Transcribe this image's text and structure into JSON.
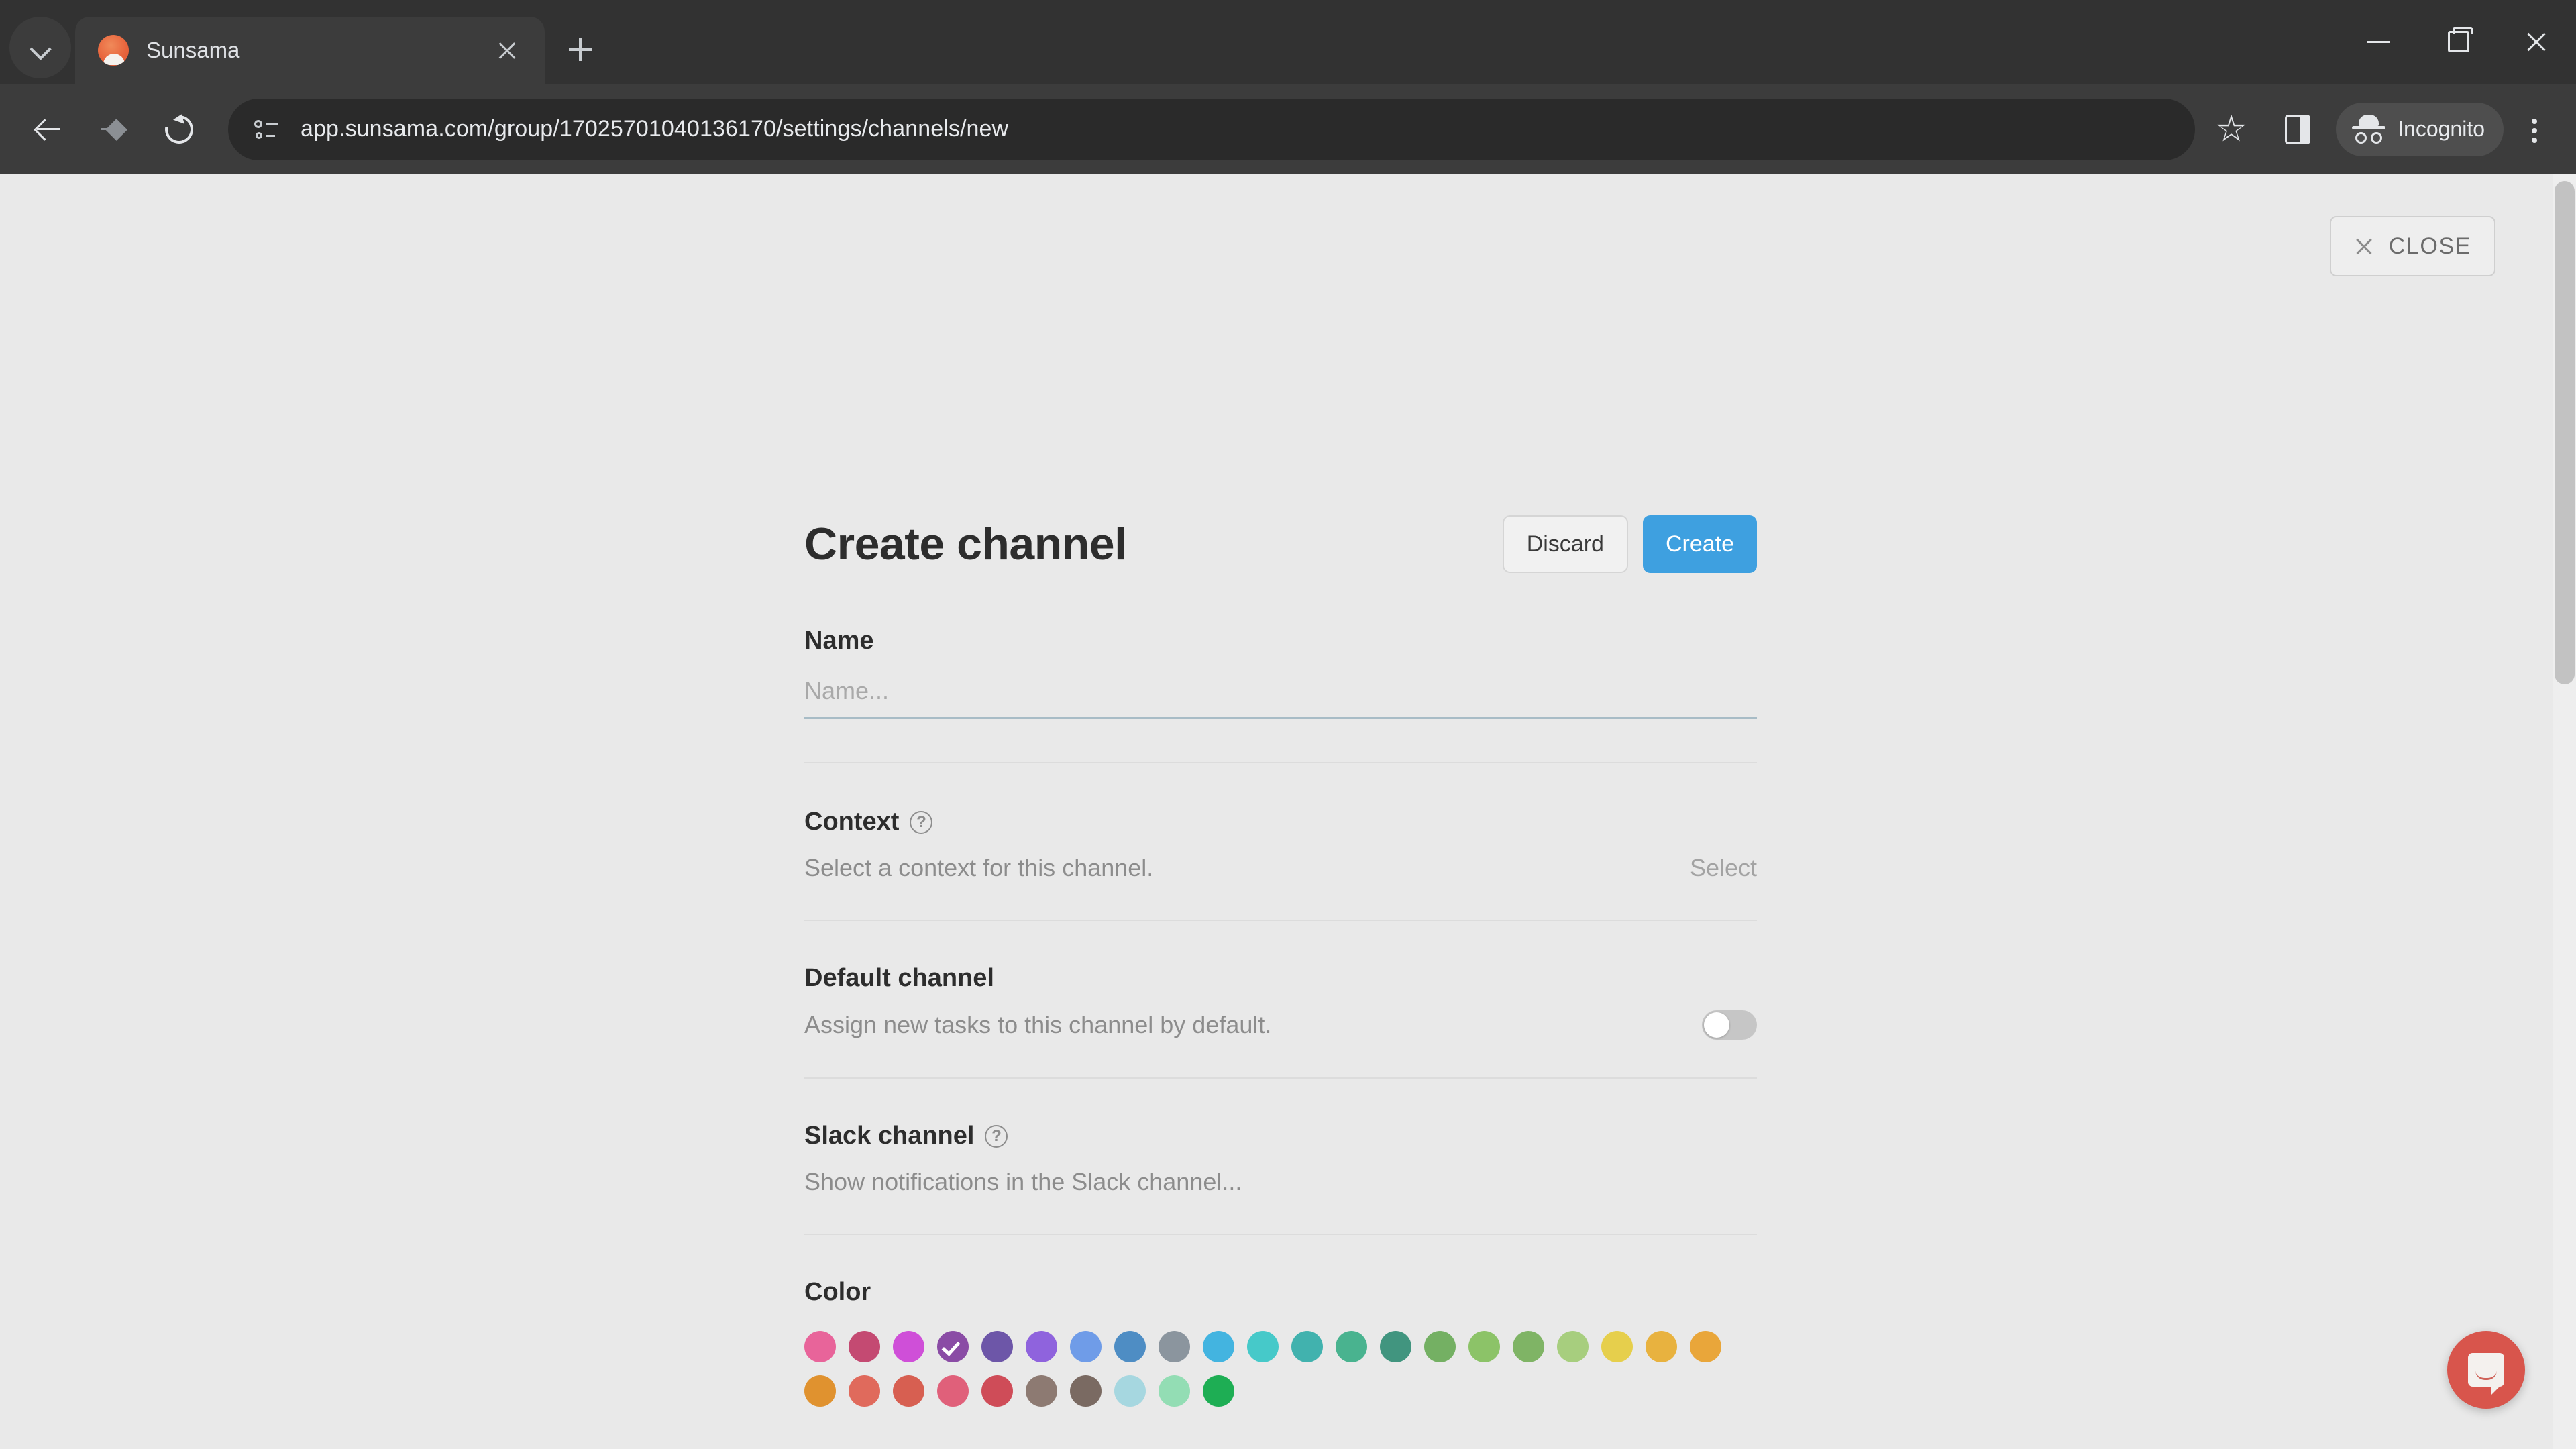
{
  "browser": {
    "tab": {
      "title": "Sunsama",
      "favicon": "sunsama-favicon"
    },
    "url": "app.sunsama.com/group/17025701040136170/settings/channels/new",
    "profile_label": "Incognito",
    "icons": {
      "tab_search": "chevron-down-icon",
      "new_tab": "plus-icon",
      "tab_close": "close-icon",
      "back": "back-arrow-icon",
      "forward": "forward-arrow-icon",
      "reload": "reload-icon",
      "site_info": "site-settings-icon",
      "bookmark": "star-icon",
      "side_panel": "side-panel-icon",
      "incognito": "incognito-spy-icon",
      "menu": "kebab-menu-icon",
      "window_minimize": "minimize-icon",
      "window_maximize": "maximize-icon",
      "window_close": "window-close-icon"
    }
  },
  "page": {
    "close_button": {
      "label": "CLOSE",
      "icon": "close-icon"
    },
    "title": "Create channel",
    "actions": {
      "discard": "Discard",
      "create": "Create"
    },
    "sections": {
      "name": {
        "label": "Name",
        "placeholder": "Name...",
        "value": ""
      },
      "context": {
        "label": "Context",
        "help_icon": "help-circle-icon",
        "description": "Select a context for this channel.",
        "action": "Select"
      },
      "default_channel": {
        "label": "Default channel",
        "description": "Assign new tasks to this channel by default.",
        "enabled": false
      },
      "slack_channel": {
        "label": "Slack channel",
        "help_icon": "help-circle-icon",
        "placeholder": "Show notifications in the Slack channel..."
      },
      "color": {
        "label": "Color",
        "selected_index": 3,
        "swatches": [
          "#e8649a",
          "#c44a72",
          "#cf4fd8",
          "#8a4ca5",
          "#6d56a8",
          "#8f63dd",
          "#6f9ce8",
          "#4e8dc4",
          "#8b959e",
          "#43b4e0",
          "#46c9c9",
          "#41b2ae",
          "#49b38f",
          "#41957f",
          "#74b063",
          "#8cc368",
          "#7fb465",
          "#a7ce7e",
          "#e6cf4c",
          "#e8b23f",
          "#e9a63a",
          "#e0922f",
          "#e06a5c",
          "#d75f51",
          "#e0607a",
          "#cf4c58",
          "#8d7a72",
          "#7a6a62",
          "#a6d7e0",
          "#93ddb4",
          "#1eae54"
        ]
      }
    },
    "intercom": {
      "icon": "intercom-chat-icon",
      "color": "#d8554c"
    }
  }
}
